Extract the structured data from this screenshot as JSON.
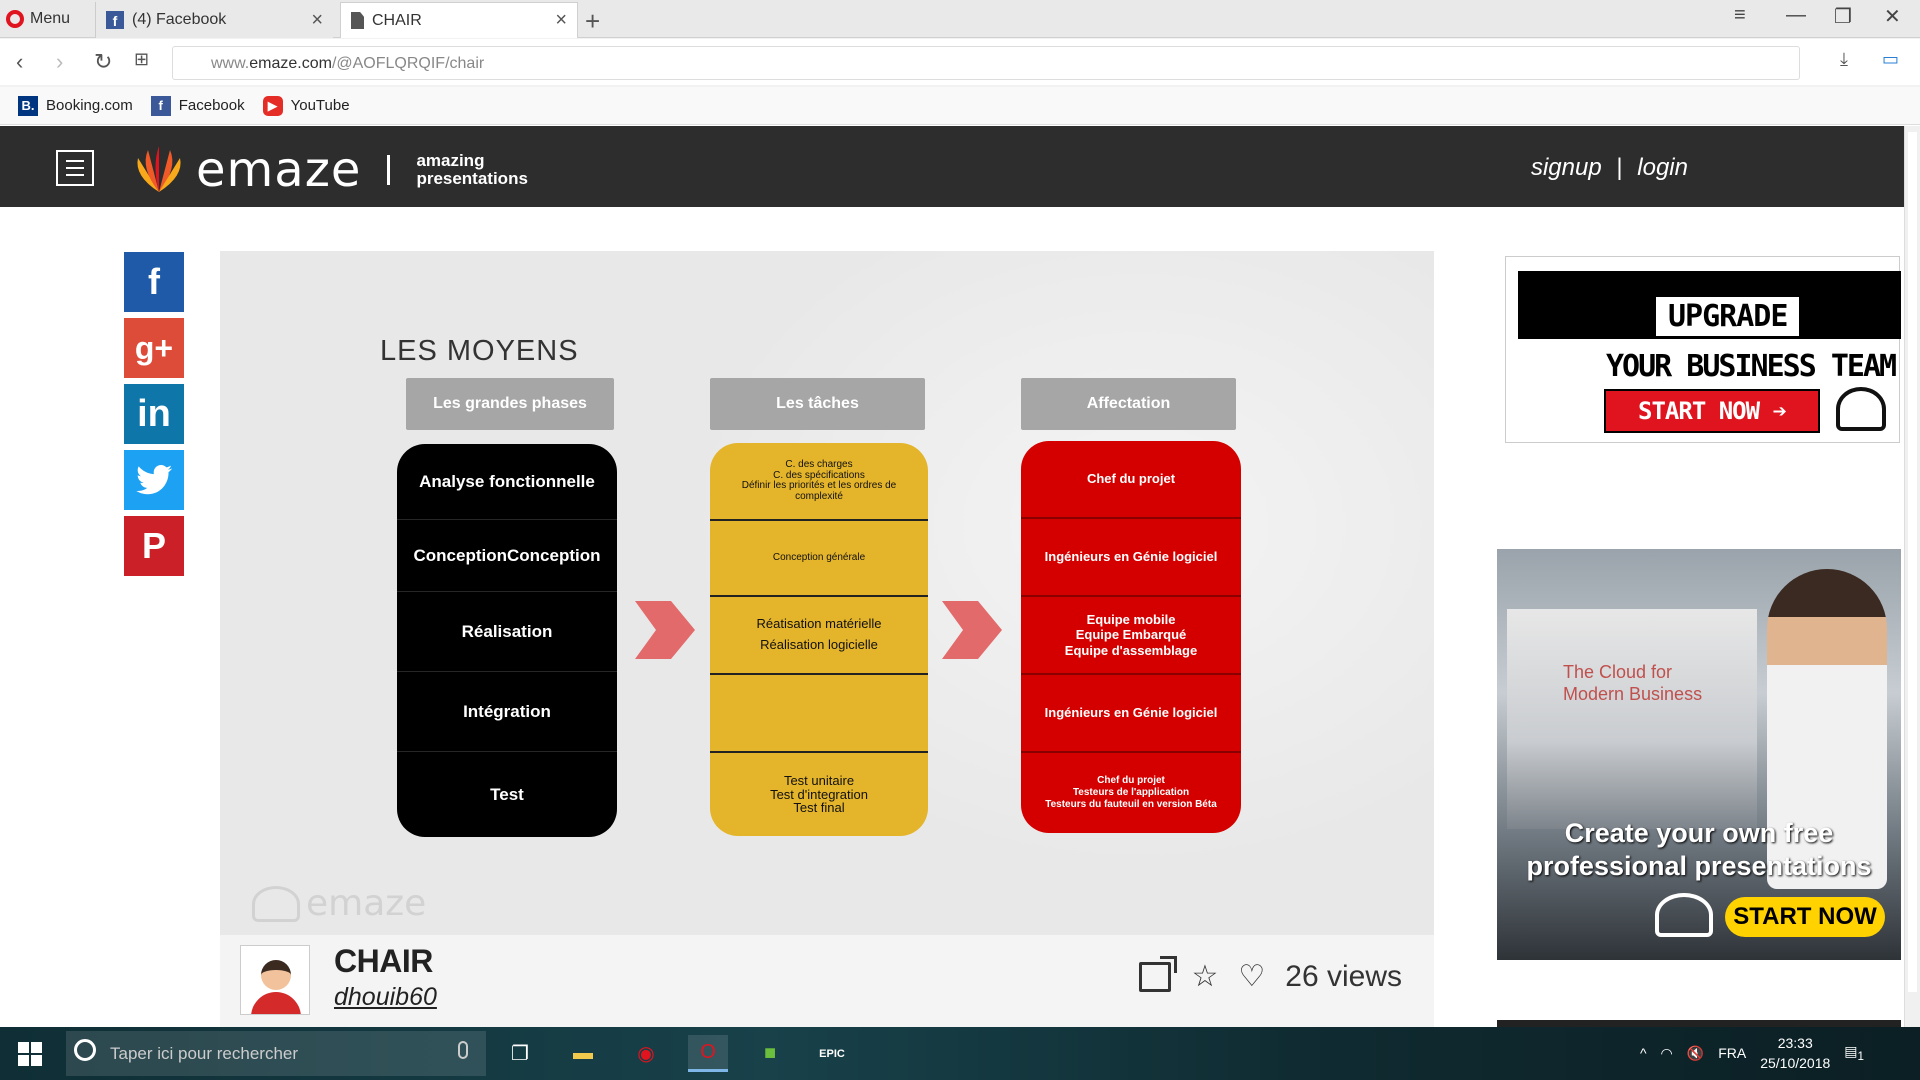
{
  "browser": {
    "menu_label": "Menu",
    "tabs": [
      {
        "label": "(4) Facebook",
        "icon": "facebook-icon"
      },
      {
        "label": "CHAIR",
        "icon": "page-icon"
      }
    ],
    "url_prefix": "www.",
    "url_domain": "emaze.com",
    "url_path": "/@AOFLQRQIF/chair",
    "bookmarks": [
      {
        "label": "Booking.com",
        "icon": "booking-icon"
      },
      {
        "label": "Facebook",
        "icon": "facebook-icon"
      },
      {
        "label": "YouTube",
        "icon": "youtube-icon"
      }
    ]
  },
  "site": {
    "logo_text": "emaze",
    "tagline_1": "amazing",
    "tagline_2": "presentations",
    "signup": "signup",
    "separator": "|",
    "login": "login"
  },
  "social": {
    "facebook": "f",
    "googleplus": "g+",
    "linkedin": "in",
    "twitter": "t",
    "pinterest": "P"
  },
  "slide": {
    "title": "LES MOYENS",
    "headers": [
      "Les grandes phases",
      "Les tâches",
      "Affectation"
    ],
    "phases": [
      "Analyse fonctionnelle",
      "ConceptionConception",
      "Réalisation",
      "Intégration",
      "Test"
    ],
    "taches": [
      [
        "C. des charges",
        "C. des spécifications",
        "Définir les priorités et les ordres de",
        "complexité"
      ],
      [
        "Conception générale"
      ],
      [
        "Réatisation matérielle",
        "Réalisation logicielle"
      ],
      [],
      [
        "Test unitaire",
        "Test d'integration",
        "Test final"
      ]
    ],
    "affectation": [
      [
        "Chef du projet"
      ],
      [
        "Ingénieurs en Génie logiciel"
      ],
      [
        "Equipe mobile",
        "Equipe Embarqué",
        "Equipe d'assemblage"
      ],
      [
        "Ingénieurs en Génie logiciel"
      ],
      [
        "Chef du projet",
        "Testeurs de l'application",
        "Testeurs du fauteuil en version Béta"
      ]
    ],
    "watermark": "emaze"
  },
  "presentation": {
    "title": "CHAIR",
    "user": "dhouib60",
    "views": "26 views"
  },
  "ads": {
    "ad1_line1": "UPGRADE",
    "ad1_line2": "YOUR BUSINESS TEAM",
    "ad1_button": "START NOW ➔",
    "ad2_screen_1": "The Cloud for",
    "ad2_screen_2": "Modern Business",
    "ad2_text_1": "Create your own free",
    "ad2_text_2": "professional presentations",
    "ad2_button": "START NOW"
  },
  "taskbar": {
    "search_placeholder": "Taper ici pour rechercher",
    "language": "FRA",
    "time": "23:33",
    "date": "25/10/2018",
    "notifications": "1"
  },
  "colors": {
    "header_bg": "#2d2d2d",
    "phase_col": "#000000",
    "tache_col": "#e4b42b",
    "affect_col": "#d40000",
    "arrow": "#e36a6a"
  }
}
